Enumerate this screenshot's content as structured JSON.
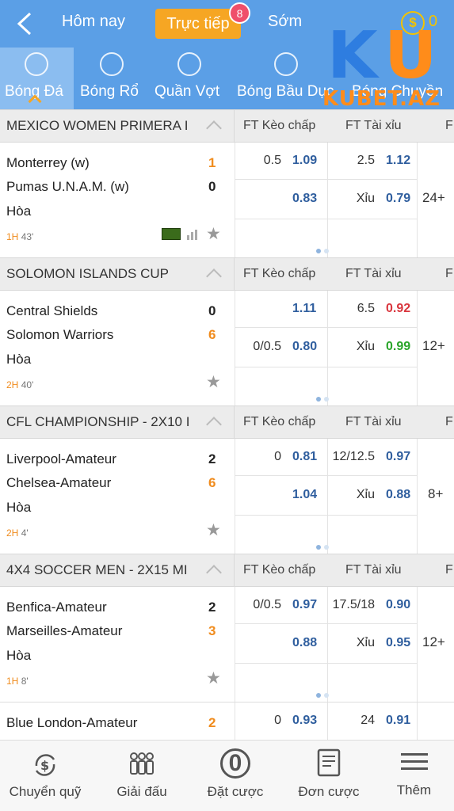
{
  "header": {
    "tabs": [
      "Hôm nay",
      "Trực tiếp",
      "Sớm"
    ],
    "live_count": "8",
    "coin_symbol": "$",
    "coin_value": "0"
  },
  "logo": {
    "main": "KU",
    "sub": "KUBET.AZ"
  },
  "sports": [
    "Bóng Đá",
    "Bóng Rổ",
    "Quần Vợt",
    "Bóng Bầu Dục",
    "Bóng Chuyền"
  ],
  "leagues": [
    {
      "name": "MEXICO WOMEN PRIMERA I",
      "col_handicap": "FT Kèo chấp",
      "col_total": "FT Tài xỉu",
      "col_more": "F",
      "home": "Monterrey (w)",
      "home_score": "1",
      "away": "Pumas U.N.A.M. (w)",
      "away_score": "0",
      "draw": "Hòa",
      "half": "1H",
      "minute": "43'",
      "hdp_line": "0.5",
      "hdp_home": "1.09",
      "hdp_away": "0.83",
      "ou_line": "2.5",
      "ou_over": "1.12",
      "ou_under_label": "Xỉu",
      "ou_under": "0.79",
      "more": "24+"
    },
    {
      "name": "SOLOMON ISLANDS CUP",
      "col_handicap": "FT Kèo chấp",
      "col_total": "FT Tài xỉu",
      "col_more": "F",
      "home": "Central Shields",
      "home_score": "0",
      "away": "Solomon Warriors",
      "away_score": "6",
      "draw": "Hòa",
      "half": "2H",
      "minute": "40'",
      "hdp_line": "",
      "hdp_home": "1.11",
      "hdp_line2": "0/0.5",
      "hdp_away": "0.80",
      "ou_line": "6.5",
      "ou_over": "0.92",
      "ou_under_label": "Xỉu",
      "ou_under": "0.99",
      "more": "12+"
    },
    {
      "name": "CFL CHAMPIONSHIP - 2X10 I",
      "col_handicap": "FT Kèo chấp",
      "col_total": "FT Tài xỉu",
      "col_more": "F",
      "home": "Liverpool-Amateur",
      "home_score": "2",
      "away": "Chelsea-Amateur",
      "away_score": "6",
      "draw": "Hòa",
      "half": "2H",
      "minute": "4'",
      "hdp_line": "0",
      "hdp_home": "0.81",
      "hdp_away": "1.04",
      "ou_line": "12/12.5",
      "ou_over": "0.97",
      "ou_under_label": "Xỉu",
      "ou_under": "0.88",
      "more": "8+"
    },
    {
      "name": "4X4 SOCCER MEN - 2X15 MI",
      "col_handicap": "FT Kèo chấp",
      "col_total": "FT Tài xỉu",
      "col_more": "F",
      "home": "Benfica-Amateur",
      "home_score": "2",
      "away": "Marseilles-Amateur",
      "away_score": "3",
      "draw": "Hòa",
      "half": "1H",
      "minute": "8'",
      "hdp_line": "0/0.5",
      "hdp_home": "0.97",
      "hdp_away": "0.88",
      "ou_line": "17.5/18",
      "ou_over": "0.90",
      "ou_under_label": "Xỉu",
      "ou_under": "0.95",
      "more": "12+"
    }
  ],
  "partial_match": {
    "home": "Blue London-Amateur",
    "home_score": "2",
    "hdp_line": "0",
    "hdp_home": "0.93",
    "ou_line": "24",
    "ou_over": "0.91"
  },
  "bottom_nav": [
    "Chuyển quỹ",
    "Giải đấu",
    "Đặt cược",
    "Đơn cược",
    "Thêm"
  ],
  "bottom_nav_bet_count": "0",
  "colors": {
    "primary": "#5b9fe6",
    "accent": "#f6a623",
    "odds": "#2f5e9e",
    "down": "#d9363e",
    "up": "#2aa52a"
  }
}
